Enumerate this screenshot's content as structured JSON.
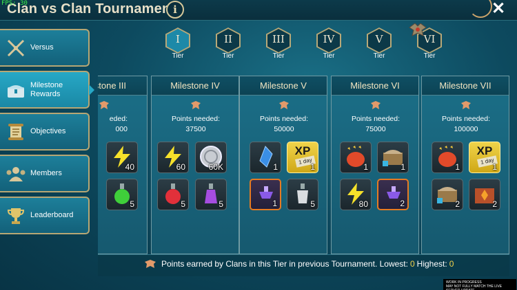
{
  "fps": "FPS: 30",
  "header": {
    "title": "Clan vs Clan Tournament",
    "info": "i",
    "close": "✕"
  },
  "sidebar": {
    "items": [
      {
        "label": "Versus",
        "icon": "crossed-swords-icon"
      },
      {
        "label": "Milestone\nRewards",
        "icon": "chest-icon"
      },
      {
        "label": "Objectives",
        "icon": "scroll-icon"
      },
      {
        "label": "Members",
        "icon": "members-icon"
      },
      {
        "label": "Leaderboard",
        "icon": "trophy-icon"
      }
    ]
  },
  "tiers": [
    {
      "num": "I",
      "label": "Tier"
    },
    {
      "num": "II",
      "label": "Tier"
    },
    {
      "num": "III",
      "label": "Tier"
    },
    {
      "num": "IV",
      "label": "Tier"
    },
    {
      "num": "V",
      "label": "Tier"
    },
    {
      "num": "VI",
      "label": "Tier"
    }
  ],
  "milestones": [
    {
      "title": "stone III",
      "points_label": "eded:",
      "points": "000",
      "items": [
        {
          "icon": "energy-bolt-icon",
          "qty": "40",
          "style": "dark"
        },
        {
          "icon": "green-potion-icon",
          "qty": "5",
          "style": "dark"
        }
      ]
    },
    {
      "title": "Milestone IV",
      "points_label": "Points needed:",
      "points": "37500",
      "items": [
        {
          "icon": "energy-bolt-icon",
          "qty": "60",
          "style": "dark"
        },
        {
          "icon": "silver-coin-icon",
          "qty": "60K",
          "style": "dark"
        },
        {
          "icon": "red-potion-icon",
          "qty": "5",
          "style": "dark"
        },
        {
          "icon": "purple-potion-icon",
          "qty": "5",
          "style": "dark"
        }
      ]
    },
    {
      "title": "Milestone V",
      "points_label": "Points needed:",
      "points": "50000",
      "items": [
        {
          "icon": "blue-shard-icon",
          "qty": "1",
          "style": "dark"
        },
        {
          "icon": "xp-boost-icon",
          "qty": "1",
          "style": "gold",
          "xp": "XP",
          "day": "1 day"
        },
        {
          "icon": "mystery-key-icon",
          "qty": "1",
          "style": "orange"
        },
        {
          "icon": "white-potion-icon",
          "qty": "5",
          "style": "dark"
        }
      ]
    },
    {
      "title": "Milestone VI",
      "points_label": "Points needed:",
      "points": "75000",
      "items": [
        {
          "icon": "red-chicken-icon",
          "qty": "1",
          "style": "dark"
        },
        {
          "icon": "chest-item-icon",
          "qty": "1",
          "style": "dark"
        },
        {
          "icon": "energy-bolt-icon",
          "qty": "80",
          "style": "dark"
        },
        {
          "icon": "mystery-key-icon",
          "qty": "2",
          "style": "orange"
        }
      ]
    },
    {
      "title": "Milestone VII",
      "points_label": "Points needed:",
      "points": "100000",
      "items": [
        {
          "icon": "red-chicken-icon",
          "qty": "1",
          "style": "dark"
        },
        {
          "icon": "xp-boost-icon",
          "qty": "1",
          "style": "gold",
          "xp": "XP",
          "day": "1 day"
        },
        {
          "icon": "chest-item-icon",
          "qty": "2",
          "style": "dark"
        },
        {
          "icon": "fire-shrine-icon",
          "qty": "2",
          "style": "dark"
        }
      ]
    }
  ],
  "footer": {
    "text": "Points earned by Clans in this Tier in previous Tournament. Lowest:",
    "lowest": "0",
    "highest_label": "Highest:",
    "highest": "0"
  },
  "watermark": {
    "line1": "WORK IN PROGRESS",
    "line2": "MAY NOT FULLY MATCH THE LIVE SERVER UPDATE"
  },
  "colors": {
    "accent": "#1d89a8",
    "gold": "#b9a978",
    "highlight": "#f2d24a"
  }
}
